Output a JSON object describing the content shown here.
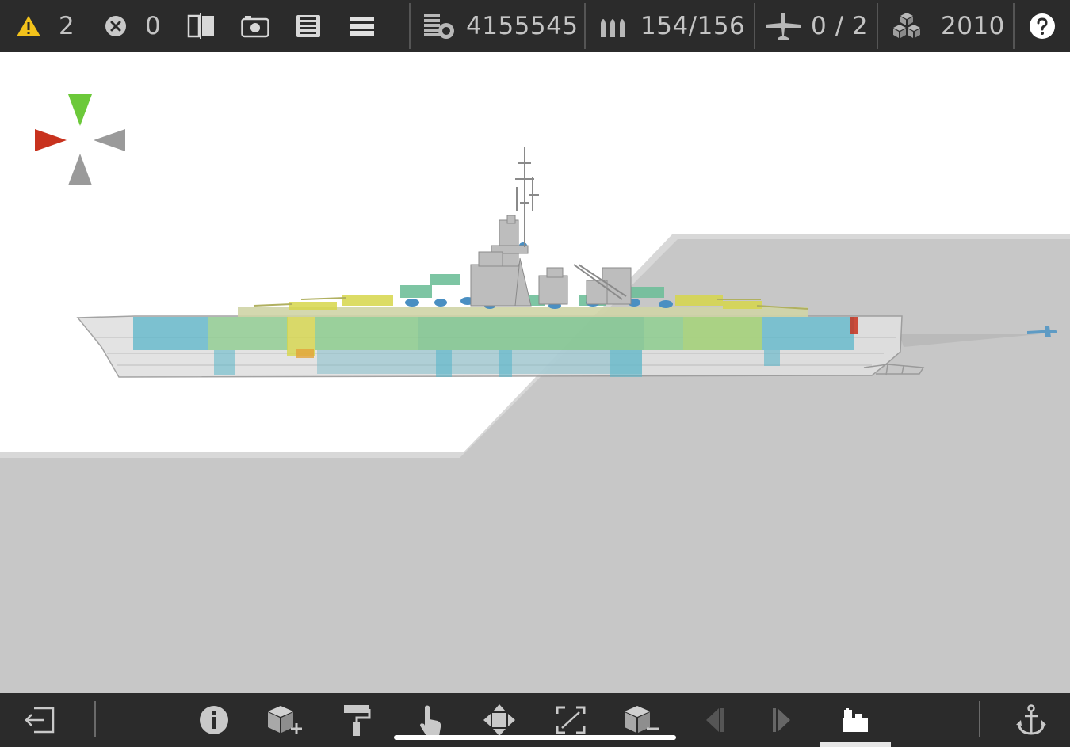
{
  "topbar": {
    "warnings_count": "2",
    "errors_count": "0",
    "cost": "4155545",
    "ammo": "154/156",
    "aircraft": "0 / 2",
    "year": "2010",
    "icons": [
      "warning-icon",
      "error-icon",
      "mirror-icon",
      "camera-icon",
      "save-icon",
      "menu-icon",
      "cost-icon",
      "ammo-icon",
      "aircraft-icon",
      "blocks-icon",
      "help-icon"
    ]
  },
  "bottombar": {
    "icons": [
      "exit-icon",
      "info-icon",
      "add-part-icon",
      "paint-icon",
      "select-icon",
      "move-icon",
      "resize-icon",
      "remove-part-icon",
      "prev-icon",
      "next-icon",
      "garage-icon",
      "anchor-icon"
    ],
    "active_tool": "garage-icon"
  },
  "colors": {
    "bar_bg": "#2b2b2b",
    "bar_text": "#c4c4c4",
    "warning": "#f2c21b",
    "gizmo_green": "#6cc93a",
    "gizmo_red": "#c8321e",
    "gizmo_gray": "#9a9a9a",
    "hull_cyan": "#5ab6c9",
    "hull_green": "#8dcc8e",
    "hull_yellow": "#d6d64a"
  }
}
